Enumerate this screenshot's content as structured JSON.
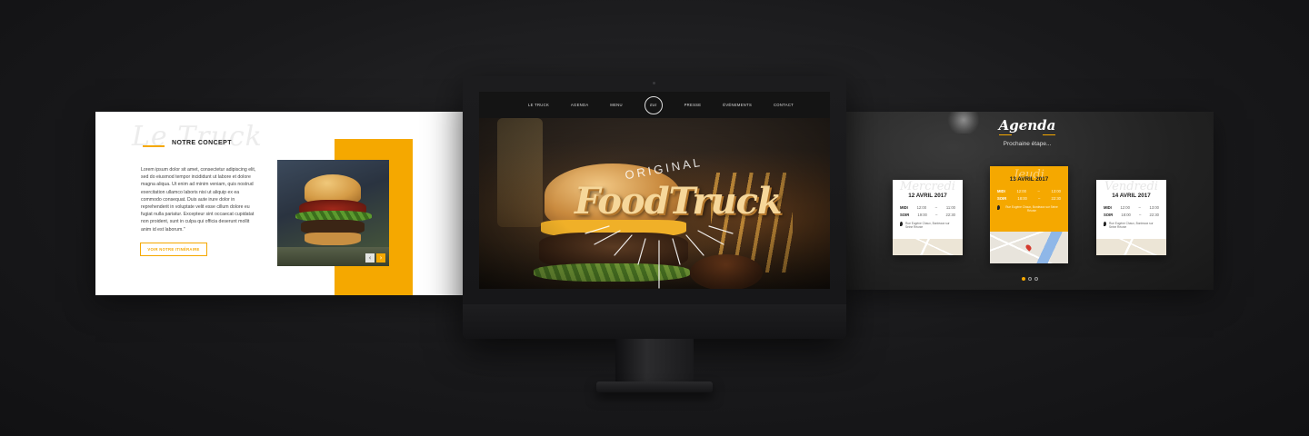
{
  "left_panel": {
    "script_title": "Le Truck",
    "concept_title": "NOTRE CONCEPT",
    "body_text": "Lorem ipsum dolor sit amet, consectetur adipiscing elit, sed do eiusmod tempor incididunt ut labore et dolore magna aliqua. Ut enim ad minim veniam, quis nostrud exercitation ullamco laboris nisi ut aliquip ex ea commodo consequat. Duis aute irure dolor in reprehenderit in voluptate velit esse cillum dolore eu fugiat nulla pariatur. Excepteur sint occaecat cupidatat non proident, sunt in culpa qui officia deserunt mollit anim id est laborum.\"",
    "button_label": "VOIR NOTRE ITINÉRAIRE",
    "prev_label": "‹",
    "next_label": "›"
  },
  "monitor": {
    "nav": {
      "items": [
        "LE TRUCK",
        "AGENDA",
        "MENU",
        "PRESSE",
        "ÉVÉNEMENTS",
        "CONTACT"
      ],
      "logo_text": "Eat"
    },
    "hero": {
      "kicker": "ORIGINAL",
      "headline": "FoodTruck"
    }
  },
  "agenda": {
    "title": "Agenda",
    "subtitle": "Prochaine étape...",
    "cards": [
      {
        "script": "Mercredi",
        "date": "12 AVRIL 2017",
        "rows": [
          {
            "label": "MIDI",
            "from": "12:00",
            "to": "11:00"
          },
          {
            "label": "SOIR",
            "from": "19:00",
            "to": "22:30"
          }
        ],
        "address": "Rue Eugène Chaux, Bordeaux sur Seine Réunie"
      },
      {
        "script": "Jeudi",
        "date": "13 AVRIL 2017",
        "rows": [
          {
            "label": "MIDI",
            "from": "12:00",
            "to": "13:00"
          },
          {
            "label": "SOIR",
            "from": "18:00",
            "to": "22:30"
          }
        ],
        "address": "Rue Eugène Chaux, Bordeaux sur Seine Réunie"
      },
      {
        "script": "Vendredi",
        "date": "14 AVRIL 2017",
        "rows": [
          {
            "label": "MIDI",
            "from": "12:00",
            "to": "13:00"
          },
          {
            "label": "SOIR",
            "from": "18:00",
            "to": "22:30"
          }
        ],
        "address": "Rue Eugène Chaux, Bordeaux sur Seine Réunie"
      }
    ],
    "active_dot": 0
  },
  "colors": {
    "accent": "#f5a800",
    "background": "#1c1c1e"
  }
}
